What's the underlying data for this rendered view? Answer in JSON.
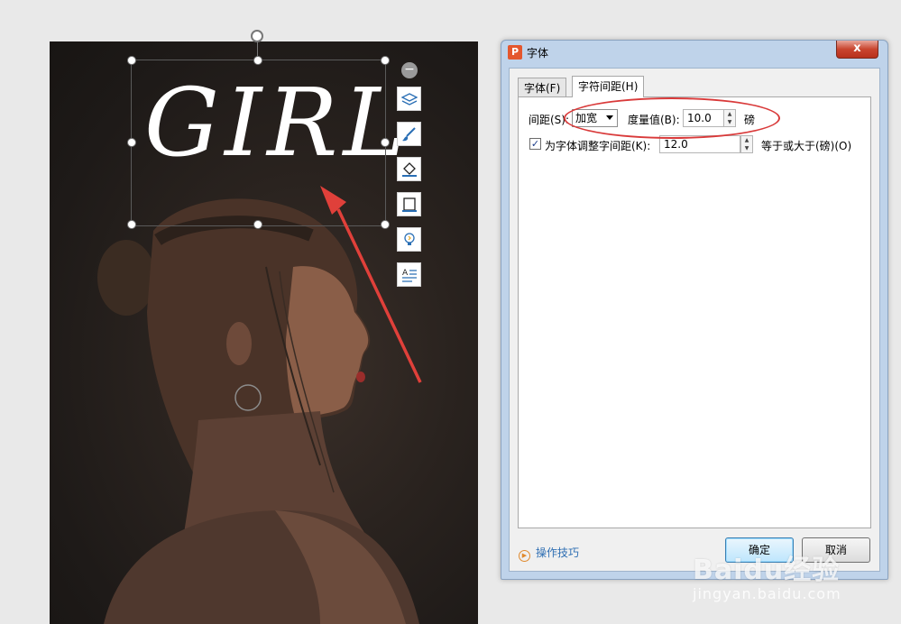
{
  "slide": {
    "title_text": "GIRL"
  },
  "floating_toolbar": {
    "collapse_icon": "minus-circle-icon",
    "tools": [
      "layers-icon",
      "brush-icon",
      "fill-icon",
      "border-icon",
      "bulb-icon",
      "text-wrap-icon"
    ]
  },
  "dialog": {
    "app_icon_letter": "P",
    "title": "字体",
    "close_label": "x",
    "tabs": [
      {
        "label": "字体(F)",
        "active": false
      },
      {
        "label": "字符间距(H)",
        "active": true
      }
    ],
    "spacing": {
      "label": "间距(S):",
      "selected": "加宽",
      "measure_label": "度量值(B):",
      "measure_value": "10.0",
      "unit": "磅"
    },
    "kerning": {
      "checked": true,
      "label": "为字体调整字间距(K):",
      "value": "12.0",
      "suffix": "等于或大于(磅)(O)"
    },
    "tips_label": "操作技巧",
    "ok_label": "确定",
    "cancel_label": "取消"
  },
  "annotation": {
    "color": "#d93a3a"
  },
  "watermark": {
    "logo": "Baidu经验",
    "url": "jingyan.baidu.com"
  }
}
